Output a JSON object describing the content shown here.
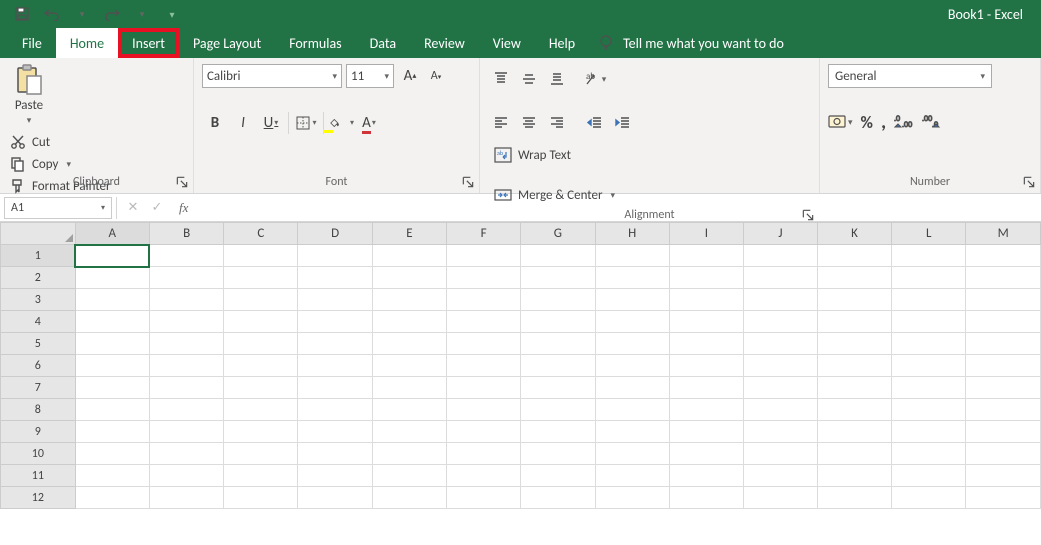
{
  "app": {
    "title": "Book1  -  Excel"
  },
  "qat": {
    "save": "save",
    "undo": "undo",
    "redo": "redo"
  },
  "tabs": {
    "file": "File",
    "home": "Home",
    "insert": "Insert",
    "page_layout": "Page Layout",
    "formulas": "Formulas",
    "data": "Data",
    "review": "Review",
    "view": "View",
    "help": "Help",
    "tellme_placeholder": "Tell me what you want to do"
  },
  "ribbon": {
    "clipboard": {
      "label": "Clipboard",
      "paste": "Paste",
      "cut": "Cut",
      "copy": "Copy",
      "format_painter": "Format Painter"
    },
    "font": {
      "label": "Font",
      "name": "Calibri",
      "size": "11",
      "bold": "B",
      "italic": "I",
      "underline": "U"
    },
    "alignment": {
      "label": "Alignment",
      "wrap": "Wrap Text",
      "merge": "Merge & Center"
    },
    "number": {
      "label": "Number",
      "format": "General",
      "percent": "%",
      "comma": ","
    }
  },
  "fx": {
    "namebox": "A1",
    "fx": "fx"
  },
  "grid": {
    "columns": [
      "A",
      "B",
      "C",
      "D",
      "E",
      "F",
      "G",
      "H",
      "I",
      "J",
      "K",
      "L",
      "M"
    ],
    "rows": [
      "1",
      "2",
      "3",
      "4",
      "5",
      "6",
      "7",
      "8",
      "9",
      "10",
      "11",
      "12"
    ],
    "selected": "A1"
  }
}
